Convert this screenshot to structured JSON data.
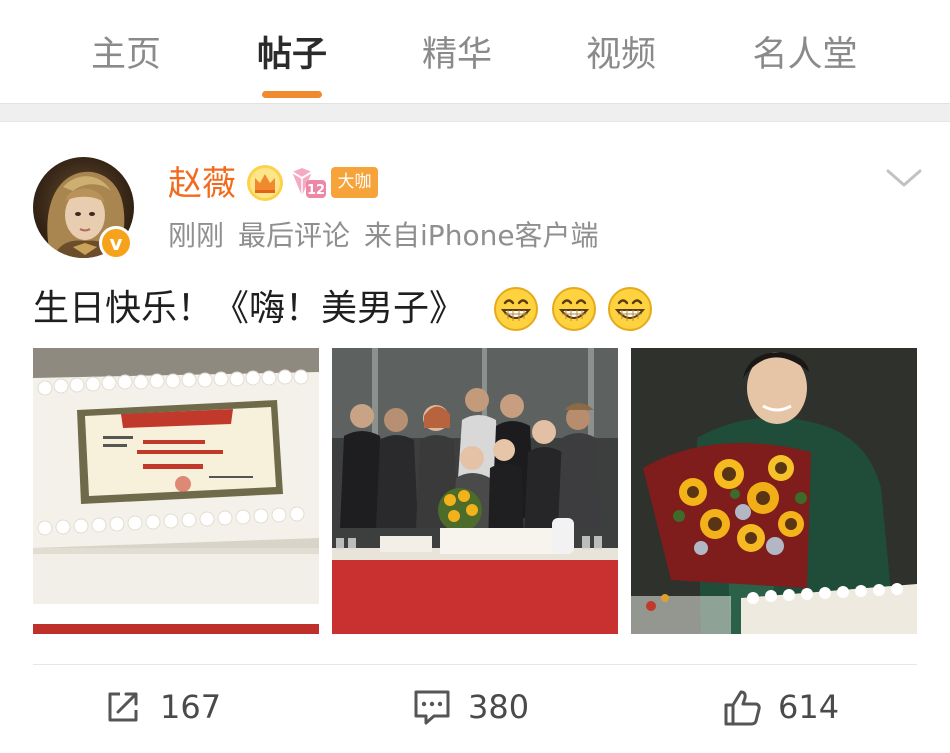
{
  "tabs": [
    {
      "label": "主页",
      "active": false
    },
    {
      "label": "帖子",
      "active": true
    },
    {
      "label": "精华",
      "active": false
    },
    {
      "label": "视频",
      "active": false
    },
    {
      "label": "名人堂",
      "active": false
    }
  ],
  "post": {
    "author": {
      "name": "赵薇",
      "level": "12",
      "badge": "大咖",
      "verified_icon": "v"
    },
    "meta": {
      "time": "刚刚",
      "type": "最后评论",
      "source": "来自iPhone客户端"
    },
    "text": "生日快乐！《嗨！美男子》",
    "emojis": [
      "grinning-face-icon",
      "grinning-face-icon",
      "grinning-face-icon"
    ],
    "photos": [
      "cake-award-photo",
      "group-party-photo",
      "sunflower-bouquet-photo"
    ]
  },
  "actions": {
    "share_count": "167",
    "comment_count": "380",
    "like_count": "614"
  },
  "colors": {
    "accent": "#f08a2e",
    "username": "#f26b1d",
    "badge": "#f6a33a"
  }
}
